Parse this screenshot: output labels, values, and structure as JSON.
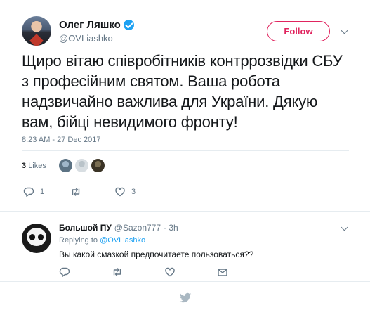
{
  "tweet": {
    "display_name": "Олег Ляшко",
    "handle": "@OVLiashko",
    "follow_label": "Follow",
    "text": "Щиро вітаю співробітників контррозвідки СБУ з професійним святом. Ваша робота надзвичайно важлива для України. Дякую вам, бійці невидимого фронту!",
    "timestamp": "8:23 AM - 27 Dec 2017",
    "likes_count": "3",
    "likes_label": "Likes",
    "actions": {
      "replies": "1",
      "retweets": "",
      "likes": "3"
    }
  },
  "reply": {
    "display_name": "Большой ПУ",
    "handle": "@Sazon777",
    "time": "· 3h",
    "replying_to_label": "Replying to",
    "replying_to_handle": "@OVLiashko",
    "text": "Вы какой смазкой предпочитаете пользоваться??"
  },
  "colors": {
    "follow_accent": "#e0245e",
    "link": "#1da1f2",
    "secondary_text": "#657786",
    "verified_badge": "#1da1f2"
  },
  "icons": [
    "chevron-down-icon",
    "reply-icon",
    "retweet-icon",
    "heart-icon",
    "envelope-icon",
    "verified-badge-icon",
    "twitter-bird-icon"
  ]
}
